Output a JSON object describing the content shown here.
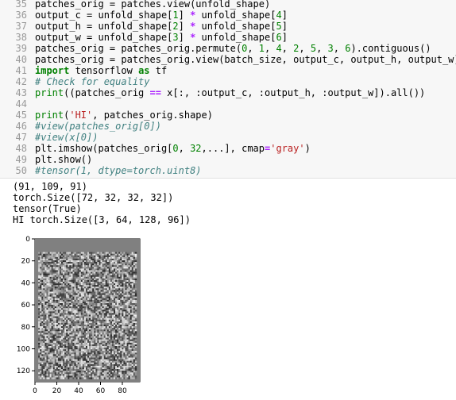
{
  "code_lines": [
    {
      "n": "35",
      "segs": [
        {
          "t": "patches_orig = patches.view(unfold_shape)",
          "c": ""
        }
      ]
    },
    {
      "n": "36",
      "segs": [
        {
          "t": "output_c = unfold_shape[",
          "c": ""
        },
        {
          "t": "1",
          "c": "num"
        },
        {
          "t": "] ",
          "c": ""
        },
        {
          "t": "*",
          "c": "op"
        },
        {
          "t": " unfold_shape[",
          "c": ""
        },
        {
          "t": "4",
          "c": "num"
        },
        {
          "t": "]",
          "c": ""
        }
      ]
    },
    {
      "n": "37",
      "segs": [
        {
          "t": "output_h = unfold_shape[",
          "c": ""
        },
        {
          "t": "2",
          "c": "num"
        },
        {
          "t": "] ",
          "c": ""
        },
        {
          "t": "*",
          "c": "op"
        },
        {
          "t": " unfold_shape[",
          "c": ""
        },
        {
          "t": "5",
          "c": "num"
        },
        {
          "t": "]",
          "c": ""
        }
      ]
    },
    {
      "n": "38",
      "segs": [
        {
          "t": "output_w = unfold_shape[",
          "c": ""
        },
        {
          "t": "3",
          "c": "num"
        },
        {
          "t": "] ",
          "c": ""
        },
        {
          "t": "*",
          "c": "op"
        },
        {
          "t": " unfold_shape[",
          "c": ""
        },
        {
          "t": "6",
          "c": "num"
        },
        {
          "t": "]",
          "c": ""
        }
      ]
    },
    {
      "n": "39",
      "segs": [
        {
          "t": "patches_orig = patches_orig.permute(",
          "c": ""
        },
        {
          "t": "0",
          "c": "num"
        },
        {
          "t": ", ",
          "c": ""
        },
        {
          "t": "1",
          "c": "num"
        },
        {
          "t": ", ",
          "c": ""
        },
        {
          "t": "4",
          "c": "num"
        },
        {
          "t": ", ",
          "c": ""
        },
        {
          "t": "2",
          "c": "num"
        },
        {
          "t": ", ",
          "c": ""
        },
        {
          "t": "5",
          "c": "num"
        },
        {
          "t": ", ",
          "c": ""
        },
        {
          "t": "3",
          "c": "num"
        },
        {
          "t": ", ",
          "c": ""
        },
        {
          "t": "6",
          "c": "num"
        },
        {
          "t": ").contiguous()",
          "c": ""
        }
      ]
    },
    {
      "n": "40",
      "segs": [
        {
          "t": "patches_orig = patches_orig.view(batch_size, output_c, output_h, output_w)",
          "c": ""
        }
      ]
    },
    {
      "n": "41",
      "segs": [
        {
          "t": "import",
          "c": "kw"
        },
        {
          "t": " tensorflow ",
          "c": ""
        },
        {
          "t": "as",
          "c": "kw"
        },
        {
          "t": " tf",
          "c": ""
        }
      ]
    },
    {
      "n": "42",
      "segs": [
        {
          "t": "# Check for equality",
          "c": "cm"
        }
      ]
    },
    {
      "n": "43",
      "segs": [
        {
          "t": "print",
          "c": "bi"
        },
        {
          "t": "((patches_orig ",
          "c": ""
        },
        {
          "t": "==",
          "c": "op"
        },
        {
          "t": " x[:, :output_c, :output_h, :output_w]).all())",
          "c": ""
        }
      ]
    },
    {
      "n": "44",
      "segs": [
        {
          "t": "",
          "c": ""
        }
      ]
    },
    {
      "n": "45",
      "segs": [
        {
          "t": "print",
          "c": "bi"
        },
        {
          "t": "(",
          "c": ""
        },
        {
          "t": "'HI'",
          "c": "str"
        },
        {
          "t": ", patches_orig.shape)",
          "c": ""
        }
      ]
    },
    {
      "n": "46",
      "segs": [
        {
          "t": "#view(patches_orig[0])",
          "c": "cm"
        }
      ]
    },
    {
      "n": "47",
      "segs": [
        {
          "t": "#view(x[0])",
          "c": "cm"
        }
      ]
    },
    {
      "n": "48",
      "segs": [
        {
          "t": "plt.imshow(patches_orig[",
          "c": ""
        },
        {
          "t": "0",
          "c": "num"
        },
        {
          "t": ", ",
          "c": ""
        },
        {
          "t": "32",
          "c": "num"
        },
        {
          "t": ",...], cmap",
          "c": ""
        },
        {
          "t": "=",
          "c": "op"
        },
        {
          "t": "'gray'",
          "c": "str"
        },
        {
          "t": ")",
          "c": ""
        }
      ]
    },
    {
      "n": "49",
      "segs": [
        {
          "t": "plt.show()",
          "c": ""
        }
      ]
    },
    {
      "n": "50",
      "segs": [
        {
          "t": "#tensor(1, dtype=torch.uint8)",
          "c": "cm"
        }
      ]
    }
  ],
  "output_lines": [
    "(91, 109, 91)",
    "torch.Size([72, 32, 32, 32])",
    "tensor(True)",
    "HI torch.Size([3, 64, 128, 96])"
  ],
  "chart_data": {
    "type": "heatmap",
    "cmap": "gray",
    "description_visible": "random noise image",
    "image_rows": 130,
    "image_cols": 96,
    "noise_region_rows": [
      12,
      127
    ],
    "noise_region_cols": [
      3,
      93
    ],
    "background_gray": 128,
    "xlim": [
      0,
      96
    ],
    "ylim": [
      0,
      130
    ],
    "xticks": [
      "0",
      "20",
      "40",
      "60",
      "80"
    ],
    "yticks": [
      "0",
      "20",
      "40",
      "60",
      "80",
      "100",
      "120"
    ],
    "xtick_values": [
      0,
      20,
      40,
      60,
      80
    ],
    "ytick_values": [
      0,
      20,
      40,
      60,
      80,
      100,
      120
    ]
  }
}
